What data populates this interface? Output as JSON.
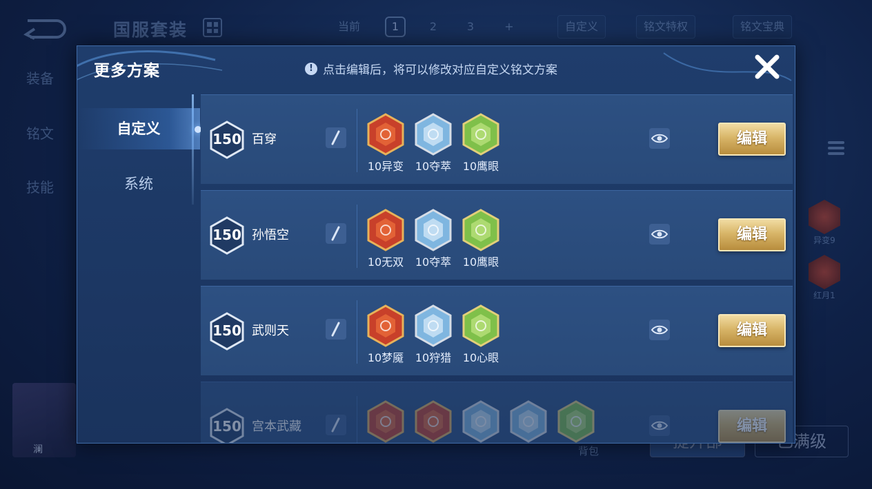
{
  "background": {
    "page_title": "国服套装",
    "tabs": [
      "当前",
      "1",
      "2",
      "3",
      "+"
    ],
    "custom_button": "自定义",
    "privilege_button": "铭文特权",
    "codex_button": "铭文宝典",
    "side_menu": [
      "装备",
      "铭文",
      "技能"
    ],
    "right_runes": [
      "异变9",
      "红月1"
    ],
    "avatar_name": "澜",
    "bag_label": "背包",
    "upgrade_button": "提升部",
    "max_level_button": "已满级"
  },
  "modal": {
    "title": "更多方案",
    "hint": "点击编辑后，将可以修改对应自定义铭文方案",
    "tabs": [
      {
        "label": "自定义",
        "active": true
      },
      {
        "label": "系统",
        "active": false
      }
    ],
    "edit_label": "编辑",
    "rows": [
      {
        "level": "150",
        "name": "百穿",
        "runes": [
          {
            "label": "10异变",
            "color": "red",
            "icon": "fortress-rune-icon"
          },
          {
            "label": "10夺萃",
            "color": "blue",
            "icon": "triquetra-rune-icon"
          },
          {
            "label": "10鹰眼",
            "color": "green",
            "icon": "clover-rune-icon"
          }
        ]
      },
      {
        "level": "150",
        "name": "孙悟空",
        "runes": [
          {
            "label": "10无双",
            "color": "red",
            "icon": "diamond-rune-icon"
          },
          {
            "label": "10夺萃",
            "color": "blue",
            "icon": "triquetra-rune-icon"
          },
          {
            "label": "10鹰眼",
            "color": "green",
            "icon": "clover-rune-icon"
          }
        ]
      },
      {
        "level": "150",
        "name": "武则天",
        "runes": [
          {
            "label": "10梦魇",
            "color": "red",
            "icon": "flame-rune-icon"
          },
          {
            "label": "10狩猎",
            "color": "blue",
            "icon": "lightning-rune-icon"
          },
          {
            "label": "10心眼",
            "color": "green",
            "icon": "leaf-rune-icon"
          }
        ]
      },
      {
        "level": "150",
        "name": "宫本武藏",
        "runes": [
          {
            "label": "",
            "color": "red",
            "icon": "diamond-rune-icon"
          },
          {
            "label": "",
            "color": "red",
            "icon": "fortress-rune-icon"
          },
          {
            "label": "",
            "color": "blue",
            "icon": "lightning-rune-icon"
          },
          {
            "label": "",
            "color": "blue",
            "icon": "triquetra-rune-icon"
          },
          {
            "label": "",
            "color": "green",
            "icon": "clover-rune-icon"
          }
        ]
      }
    ]
  },
  "colors": {
    "red": "#c8402a",
    "blue": "#7fb6e0",
    "green": "#7fc04a",
    "gold": "#d8b568"
  }
}
